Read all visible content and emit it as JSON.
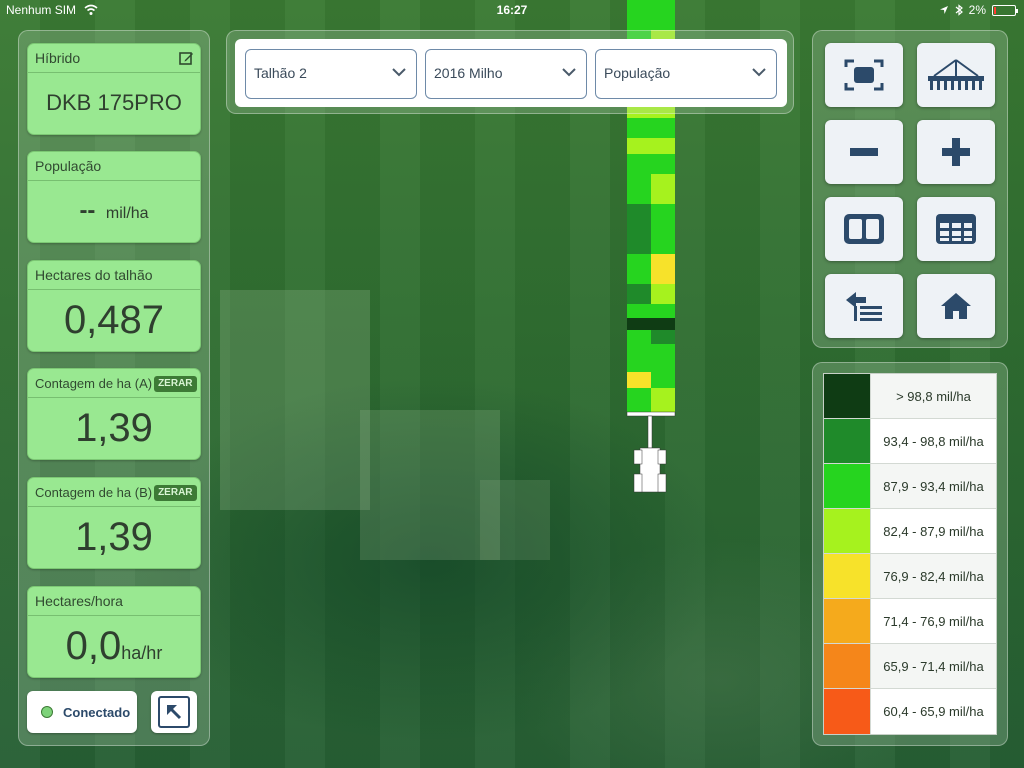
{
  "status_bar": {
    "carrier": "Nenhum SIM",
    "time": "16:27",
    "battery": "2%"
  },
  "left_panel": {
    "cards": [
      {
        "title": "Híbrido",
        "value": "DKB 175PRO",
        "unit": ""
      },
      {
        "title": "População",
        "value": "--",
        "unit": "mil/ha"
      },
      {
        "title": "Hectares do talhão",
        "value": "0,487",
        "unit": ""
      },
      {
        "title": "Contagem de ha (A)",
        "value": "1,39",
        "unit": "",
        "action": "ZERAR"
      },
      {
        "title": "Contagem de ha (B)",
        "value": "1,39",
        "unit": "",
        "action": "ZERAR"
      },
      {
        "title": "Hectares/hora",
        "value": "0,0",
        "unit": "ha/hr"
      }
    ],
    "connection": {
      "label": "Conectado",
      "color": "#7ed37a"
    }
  },
  "top_bar": {
    "selects": [
      {
        "value": "Talhão 2"
      },
      {
        "value": "2016 Milho"
      },
      {
        "value": "População"
      }
    ]
  },
  "tools": [
    {
      "icon": "fit-screen-icon"
    },
    {
      "icon": "planter-icon"
    },
    {
      "icon": "minus-icon"
    },
    {
      "icon": "plus-icon"
    },
    {
      "icon": "split-view-icon"
    },
    {
      "icon": "table-icon"
    },
    {
      "icon": "list-back-icon"
    },
    {
      "icon": "home-icon"
    }
  ],
  "legend": [
    {
      "label": "> 98,8 mil/ha",
      "color": "#0f3c14"
    },
    {
      "label": "93,4 - 98,8 mil/ha",
      "color": "#1f8a2a"
    },
    {
      "label": "87,9 - 93,4 mil/ha",
      "color": "#26d41f"
    },
    {
      "label": "82,4 - 87,9 mil/ha",
      "color": "#a6f21e"
    },
    {
      "label": "76,9 - 82,4 mil/ha",
      "color": "#f7e22a"
    },
    {
      "label": "71,4 - 76,9 mil/ha",
      "color": "#f5aa1c"
    },
    {
      "label": "65,9 - 71,4 mil/ha",
      "color": "#f5861a"
    },
    {
      "label": "60,4 - 65,9 mil/ha",
      "color": "#f75a18"
    }
  ],
  "colors": {
    "card_bg": "#99e891",
    "accent_text": "#2c4a6a"
  }
}
